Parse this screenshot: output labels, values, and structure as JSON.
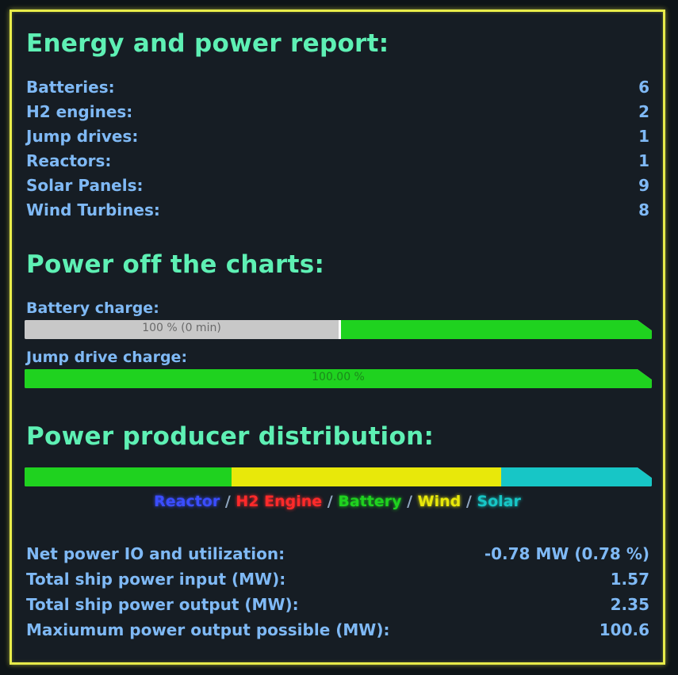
{
  "energy_report": {
    "title": "Energy and power report:",
    "items": [
      {
        "label": "Batteries:",
        "value": "6"
      },
      {
        "label": "H2 engines:",
        "value": "2"
      },
      {
        "label": "Jump drives:",
        "value": "1"
      },
      {
        "label": "Reactors:",
        "value": "1"
      },
      {
        "label": "Solar Panels:",
        "value": "9"
      },
      {
        "label": "Wind Turbines:",
        "value": "8"
      }
    ]
  },
  "charts": {
    "title": "Power off the charts:",
    "battery": {
      "label": "Battery charge:",
      "text": "100 % (0 min)",
      "charge_fraction": 1.0
    },
    "jump": {
      "label": "Jump drive charge:",
      "text": "100.00 %",
      "charge_fraction": 1.0
    }
  },
  "distribution": {
    "title": "Power producer distribution:",
    "segments": [
      {
        "name": "Battery",
        "fraction": 0.33,
        "color": "#1fd21f"
      },
      {
        "name": "Wind",
        "fraction": 0.43,
        "color": "#e8e80a"
      },
      {
        "name": "Solar",
        "fraction": 0.24,
        "color": "#17c6c6"
      }
    ],
    "legend": {
      "reactor": "Reactor",
      "h2": "H2 Engine",
      "battery": "Battery",
      "wind": "Wind",
      "solar": "Solar",
      "separator": " / "
    },
    "legend_colors": {
      "reactor": "#3a4dff",
      "h2": "#ff2a2a",
      "battery": "#1fd21f",
      "wind": "#e8e80a",
      "solar": "#17c6c6"
    }
  },
  "stats": [
    {
      "label": "Net power IO and utilization:",
      "value": "-0.78 MW (0.78 %)"
    },
    {
      "label": "Total ship power input (MW):",
      "value": "1.57"
    },
    {
      "label": "Total ship power output (MW):",
      "value": "2.35"
    },
    {
      "label": "Maxiumum power output possible (MW):",
      "value": "100.6"
    }
  ],
  "colors": {
    "heading": "#5ef0b4",
    "text": "#7fb9f5",
    "frame": "#e8ec4a",
    "bar_green": "#1fd21f",
    "bar_gray": "#c8c8c8"
  }
}
